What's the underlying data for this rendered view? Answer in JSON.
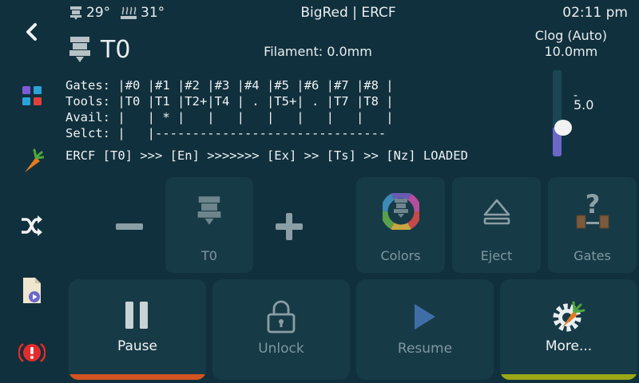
{
  "header": {
    "extruder_temp": "29°",
    "bed_temp": "31°",
    "title": "BigRed | ERCF",
    "time": "02:11 pm"
  },
  "tool": {
    "name": "T0",
    "filament": "Filament: 0.0mm"
  },
  "clog": {
    "label": "Clog (Auto)",
    "value": "10.0mm",
    "slider_value": "5.0",
    "slider_tick": "-",
    "slider_fraction": 0.3
  },
  "gates_table": {
    "gates": "Gates: |#0 |#1 |#2 |#3 |#4 |#5 |#6 |#7 |#8 |",
    "tools": "Tools: |T0 |T1 |T2+|T4 | . |T5+| . |T7 |T8 |",
    "avail": "Avail: |   | * |   |   |   |   |   |   |   |",
    "selct": "Selct: |   |-------------------------------"
  },
  "status_line": "ERCF [T0] >>> [En] >>>>>>> [Ex] >> [Ts] >> [Nz] LOADED",
  "controls": {
    "tool_button": "T0",
    "colors": "Colors",
    "eject": "Eject",
    "gates": "Gates"
  },
  "actions": {
    "pause": "Pause",
    "unlock": "Unlock",
    "resume": "Resume",
    "more": "More..."
  },
  "colors": {
    "background": "#11303d",
    "tile": "#173a47",
    "pause_bar": "#d35420",
    "more_bar": "#9aa815",
    "error": "#e32b2b",
    "slider_fill": "#6b68c8"
  }
}
